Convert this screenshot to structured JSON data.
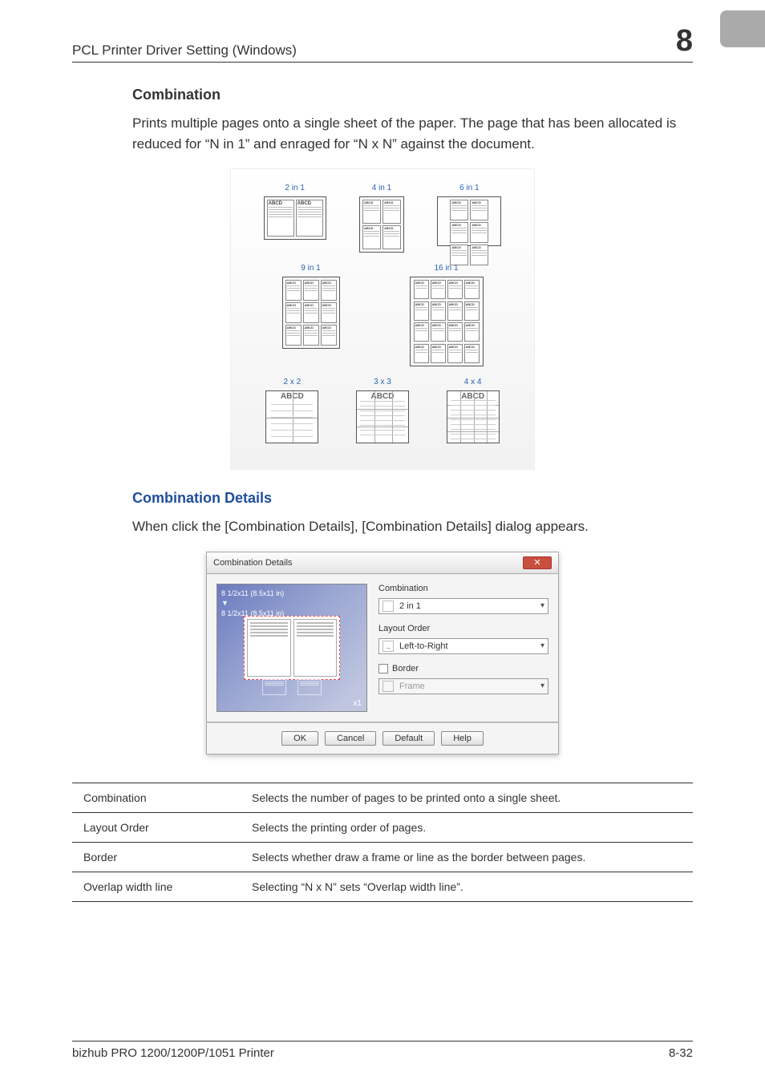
{
  "header": {
    "title": "PCL Printer Driver Setting (Windows)",
    "chapter": "8"
  },
  "sections": {
    "combination": {
      "heading": "Combination",
      "body": "Prints multiple pages onto a single sheet of the paper. The page that has been allocated is reduced for “N in 1” and enraged for “N x N” against the document."
    },
    "combination_details": {
      "heading": "Combination Details",
      "body": "When click the [Combination Details], [Combination Details] dialog appears."
    }
  },
  "figure": {
    "labels": {
      "2in1": "2 in 1",
      "4in1": "4 in 1",
      "6in1": "6 in 1",
      "9in1": "9 in 1",
      "16in1": "16 in 1",
      "2x2": "2 x 2",
      "3x3": "3 x 3",
      "4x4": "4 x 4"
    },
    "abcd": "ABCD"
  },
  "dialog": {
    "title": "Combination Details",
    "preview_dim1": "8 1/2x11 (8.5x11 in)",
    "preview_dim2": "8 1/2x11 (8.5x11 in)",
    "x1": "x1",
    "right": {
      "label_combination": "Combination",
      "value_combination": "2 in 1",
      "label_layout": "Layout Order",
      "value_layout": "Left-to-Right",
      "checkbox_border": "Border",
      "value_frame": "Frame"
    },
    "buttons": {
      "ok": "OK",
      "cancel": "Cancel",
      "default": "Default",
      "help": "Help"
    }
  },
  "table": {
    "rows": [
      {
        "name": "Combination",
        "desc": "Selects the number of pages to be printed onto a single sheet."
      },
      {
        "name": "Layout Order",
        "desc": "Selects the printing order of pages."
      },
      {
        "name": "Border",
        "desc": "Selects whether draw a frame or line as the border between pages."
      },
      {
        "name": "Overlap width line",
        "desc": "Selecting “N x N” sets “Overlap width line”."
      }
    ]
  },
  "footer": {
    "product": "bizhub PRO 1200/1200P/1051 Printer",
    "page": "8-32"
  }
}
